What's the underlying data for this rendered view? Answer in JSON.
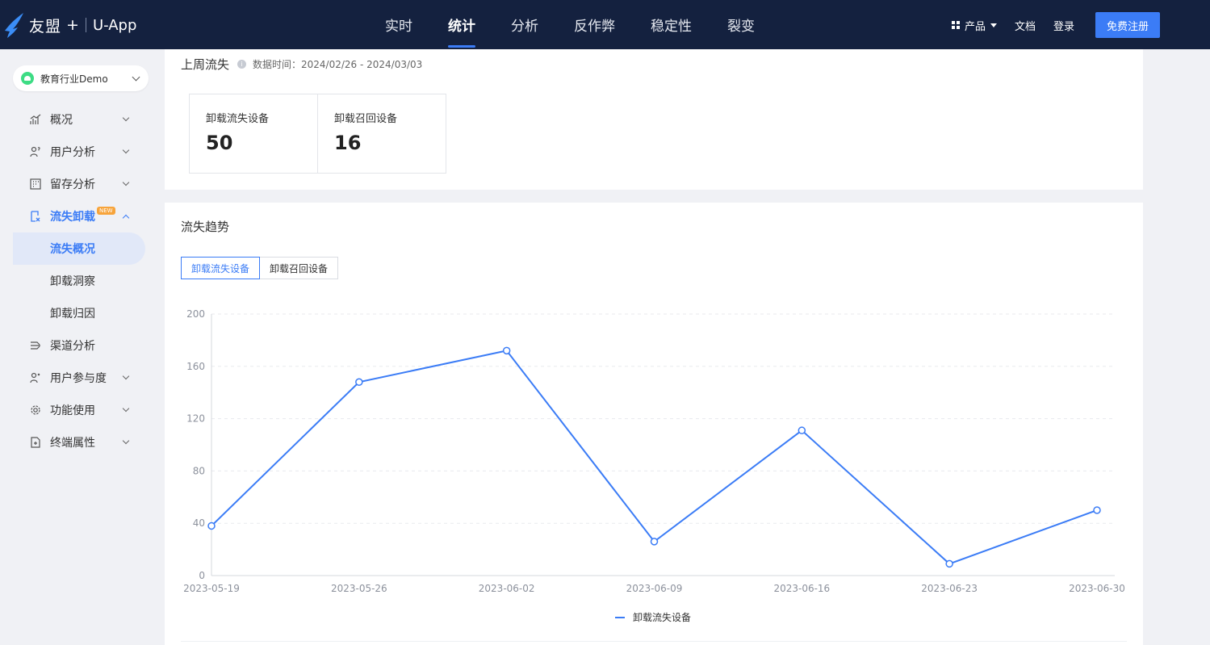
{
  "topbar": {
    "brand": "友盟",
    "brand_plus": "+",
    "product": "U-App",
    "tabs": [
      {
        "label": "实时"
      },
      {
        "label": "统计"
      },
      {
        "label": "分析"
      },
      {
        "label": "反作弊"
      },
      {
        "label": "稳定性"
      },
      {
        "label": "裂变"
      }
    ],
    "active_tab": 1,
    "products_label": "产品",
    "docs_label": "文档",
    "login_label": "登录",
    "register_label": "免费注册"
  },
  "sidebar": {
    "app_name": "教育行业Demo",
    "items": [
      {
        "label": "概况",
        "icon": "chart-icon"
      },
      {
        "label": "用户分析",
        "icon": "user-question-icon"
      },
      {
        "label": "留存分析",
        "icon": "grid-table-icon"
      },
      {
        "label": "流失卸载",
        "icon": "uninstall-icon",
        "badge": "NEW"
      },
      {
        "label": "渠道分析",
        "icon": "channel-icon"
      },
      {
        "label": "用户参与度",
        "icon": "engagement-icon"
      },
      {
        "label": "功能使用",
        "icon": "gear-icon"
      },
      {
        "label": "终端属性",
        "icon": "device-icon"
      }
    ],
    "sub_items": [
      {
        "label": "流失概况"
      },
      {
        "label": "卸载洞察"
      },
      {
        "label": "卸载归因"
      }
    ]
  },
  "last_week": {
    "title": "上周流失",
    "data_time": "数据时间：2024/02/26 - 2024/03/03",
    "stats": [
      {
        "label": "卸载流失设备",
        "value": "50"
      },
      {
        "label": "卸载召回设备",
        "value": "16"
      }
    ]
  },
  "trend": {
    "title": "流失趋势",
    "tabs": [
      {
        "label": "卸载流失设备"
      },
      {
        "label": "卸载召回设备"
      }
    ],
    "active_tab": 0
  },
  "chart_data": {
    "type": "line",
    "x": [
      "2023-05-19",
      "2023-05-26",
      "2023-06-02",
      "2023-06-09",
      "2023-06-16",
      "2023-06-23",
      "2023-06-30"
    ],
    "series": [
      {
        "name": "卸载流失设备",
        "values": [
          38,
          148,
          172,
          26,
          111,
          9,
          50
        ],
        "color": "#3b7cf6"
      }
    ],
    "yticks": [
      0,
      40,
      80,
      120,
      160,
      200
    ],
    "ylim": [
      0,
      200
    ],
    "grid": true,
    "legend": "bottom-center"
  }
}
